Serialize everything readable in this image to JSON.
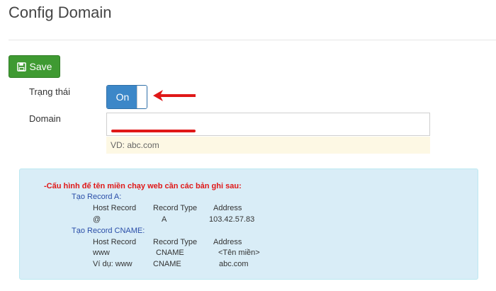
{
  "page": {
    "title": "Config Domain"
  },
  "toolbar": {
    "save_label": "Save"
  },
  "form": {
    "status_label": "Trạng thái",
    "status_toggle": "On",
    "domain_label": "Domain",
    "domain_value": "",
    "domain_hint": "VD: abc.com"
  },
  "info": {
    "heading": "-Cấu hình để tên miền chạy web cần các bản ghi sau:",
    "record_a": {
      "title": "Tạo Record A:",
      "headers": [
        "Host Record",
        "Record Type",
        "Address"
      ],
      "row": [
        "@",
        "A",
        "103.42.57.83"
      ]
    },
    "record_cname": {
      "title": "Tạo Record CNAME:",
      "headers": [
        "Host Record",
        "Record Type",
        "Address"
      ],
      "row": [
        "www",
        "CNAME",
        "<Tên miền>"
      ],
      "example": [
        "Ví dụ: www",
        "CNAME",
        "abc.com"
      ]
    }
  },
  "colors": {
    "save_button": "#3f9a32",
    "toggle_on": "#3c87c8",
    "annotation_red": "#e01818",
    "info_bg": "#d9edf7",
    "hint_bg": "#fdf8e4"
  }
}
